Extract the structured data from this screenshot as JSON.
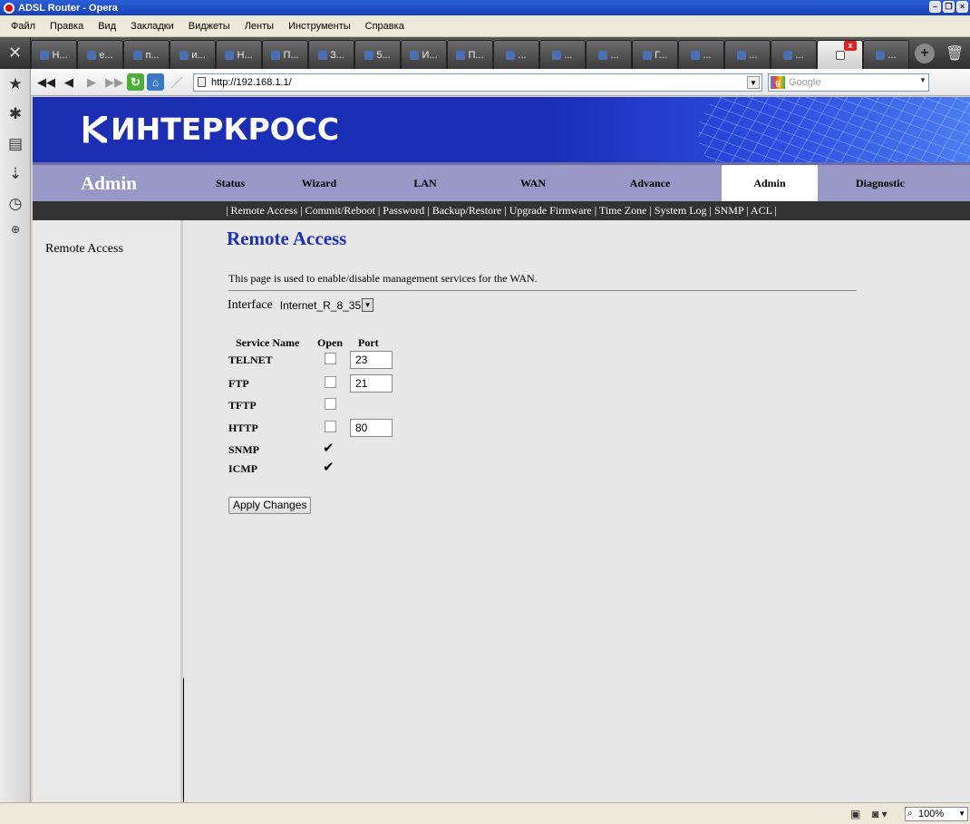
{
  "window": {
    "title": "ADSL Router - Opera"
  },
  "menu": [
    "Файл",
    "Правка",
    "Вид",
    "Закладки",
    "Виджеты",
    "Ленты",
    "Инструменты",
    "Справка"
  ],
  "tabs": [
    "Н...",
    "е...",
    "п...",
    "и...",
    "Н...",
    "П...",
    "З...",
    "5...",
    "И...",
    "П...",
    "...",
    "...",
    "...",
    "Г...",
    "...",
    "...",
    "...",
    "",
    "..."
  ],
  "address": {
    "url": "http://192.168.1.1/",
    "search_placeholder": "Google"
  },
  "page": {
    "logo_text": "ИНТЕРКРОСС",
    "section_title": "Admin",
    "nav": [
      "Status",
      "Wizard",
      "LAN",
      "WAN",
      "Advance",
      "Admin",
      "Diagnostic"
    ],
    "active_nav": "Admin",
    "subnav": "| Remote Access | Commit/Reboot | Password | Backup/Restore | Upgrade Firmware | Time Zone | System Log | SNMP | ACL |",
    "sidemenu_item": "Remote Access",
    "heading": "Remote Access",
    "description": "This page is used to enable/disable management services for the WAN.",
    "interface_label": "Interface",
    "interface_value": "Internet_R_8_35",
    "table": {
      "headers": {
        "service": "Service Name",
        "open": "Open",
        "port": "Port"
      },
      "rows": [
        {
          "name": "TELNET",
          "open": false,
          "port": "23"
        },
        {
          "name": "FTP",
          "open": false,
          "port": "21"
        },
        {
          "name": "TFTP",
          "open": false,
          "port": null
        },
        {
          "name": "HTTP",
          "open": false,
          "port": "80"
        },
        {
          "name": "SNMP",
          "open": true,
          "port": null
        },
        {
          "name": "ICMP",
          "open": true,
          "port": null
        }
      ]
    },
    "apply_label": "Apply Changes"
  },
  "status": {
    "zoom": "100%"
  }
}
